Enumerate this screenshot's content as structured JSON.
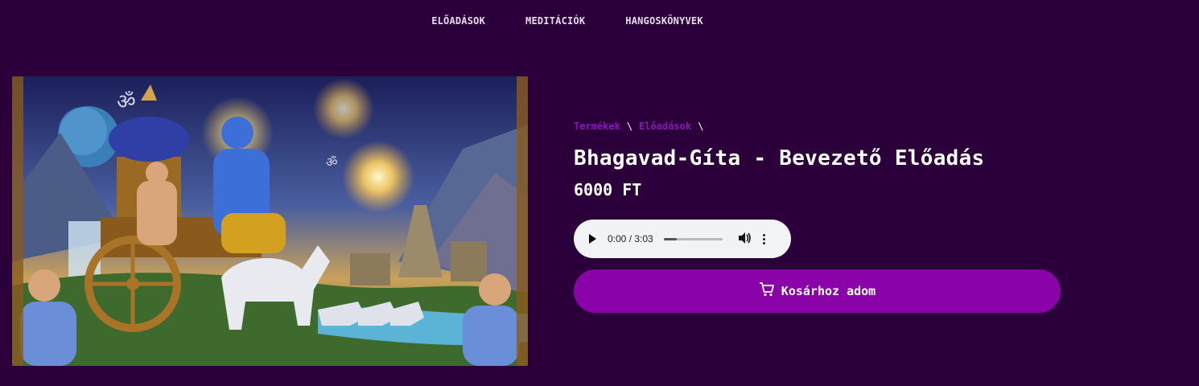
{
  "nav": {
    "items": [
      "ELŐADÁSOK",
      "MEDITÁCIÓK",
      "HANGOSKÖNYVEK"
    ]
  },
  "breadcrumb": {
    "items": [
      "Termékek",
      "Előadások"
    ],
    "separator": "\\"
  },
  "product": {
    "title": "Bhagavad-Gíta - Bevezető Előadás",
    "price": "6000 FT",
    "image_icon": "krishna-arjuna-chariot-painting"
  },
  "audio": {
    "time": "0:00 / 3:03",
    "progress": 0.22
  },
  "cart": {
    "label": "Kosárhoz adom",
    "icon": "cart-icon"
  },
  "colors": {
    "background": "#2b003a",
    "accent": "#8903a8",
    "link": "#8a17b4"
  }
}
